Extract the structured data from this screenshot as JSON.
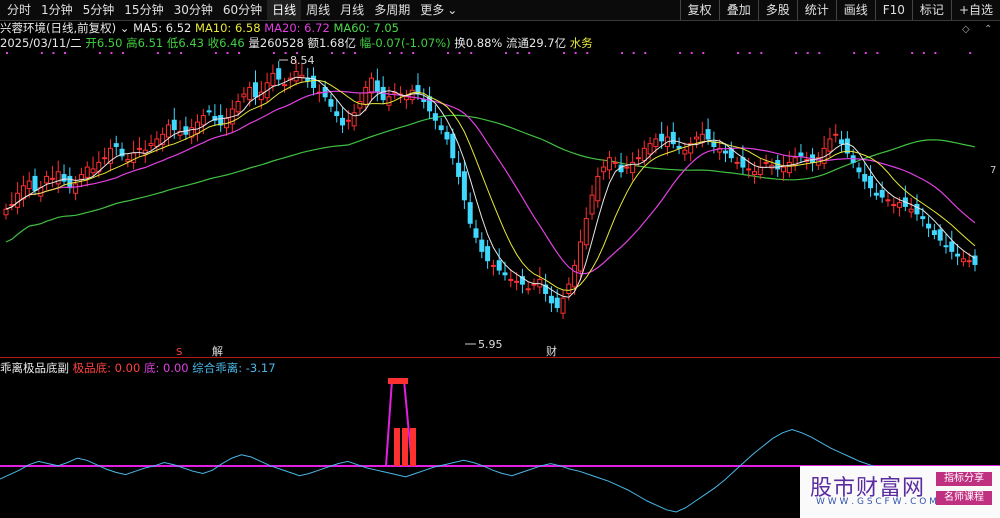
{
  "toolbar": {
    "periods": [
      "分时",
      "1分钟",
      "5分钟",
      "15分钟",
      "30分钟",
      "60分钟",
      "日线",
      "周线",
      "月线",
      "多周期",
      "更多"
    ],
    "active_period": "日线",
    "right_buttons": [
      "复权",
      "叠加",
      "多股",
      "统计",
      "画线",
      "F10",
      "标记",
      "+自选"
    ]
  },
  "info": {
    "stock_name": "兴蓉环境",
    "mode": "(日线,前复权)",
    "ma5": "MA5: 6.52",
    "ma10": "MA10: 6.58",
    "ma20": "MA20: 6.72",
    "ma60": "MA60: 7.05",
    "date": "2025/03/11/二",
    "open": "开6.50",
    "high": "高6.51",
    "low": "低6.43",
    "close": "收6.46",
    "volume": "量260528",
    "amount": "额1.68亿",
    "change": "幅-0.07(-1.07%)",
    "turnover": "换0.88%",
    "float": "流通29.7亿",
    "sector": "水务"
  },
  "annotations": {
    "high_mark": "8.54",
    "low_mark": "5.95",
    "event1": "S",
    "event2": "解",
    "event3": "财",
    "right_axis_mark": "7"
  },
  "indicator": {
    "name": "乖离极品底副",
    "label1": "极品底: 0.00",
    "label2": "底: 0.00",
    "label3": "综合乖离: -3.17"
  },
  "watermark": {
    "title": "股市财富网",
    "url": "W W W . G S C F W . C O M",
    "badge1": "指标分享",
    "badge2": "名师课程"
  },
  "colors": {
    "up": "#ff3030",
    "down": "#40d8ff",
    "ma5": "#e8e8e8",
    "ma10": "#e8e83a",
    "ma20": "#e040e0",
    "ma60": "#40c040",
    "indicator_line": "#4ab8e8",
    "indicator_base": "#e020e0"
  },
  "chart_data": {
    "type": "candlestick",
    "price_range": [
      5.95,
      8.54
    ],
    "highest": 8.54,
    "lowest": 5.95,
    "closes": [
      7.05,
      7.1,
      7.22,
      7.3,
      7.35,
      7.25,
      7.28,
      7.4,
      7.38,
      7.45,
      7.35,
      7.28,
      7.32,
      7.42,
      7.5,
      7.48,
      7.55,
      7.6,
      7.7,
      7.72,
      7.62,
      7.58,
      7.65,
      7.7,
      7.68,
      7.75,
      7.8,
      7.85,
      7.95,
      7.9,
      7.88,
      7.85,
      7.92,
      7.98,
      8.05,
      8.1,
      8.0,
      7.95,
      8.02,
      8.12,
      8.2,
      8.28,
      8.35,
      8.25,
      8.3,
      8.4,
      8.5,
      8.44,
      8.38,
      8.45,
      8.52,
      8.48,
      8.42,
      8.35,
      8.3,
      8.25,
      8.15,
      8.05,
      7.95,
      8.0,
      8.08,
      8.2,
      8.35,
      8.45,
      8.3,
      8.22,
      8.25,
      8.3,
      8.28,
      8.25,
      8.32,
      8.28,
      8.2,
      8.1,
      8.0,
      7.9,
      7.8,
      7.6,
      7.4,
      7.15,
      6.9,
      6.75,
      6.6,
      6.5,
      6.45,
      6.4,
      6.35,
      6.3,
      6.28,
      6.25,
      6.2,
      6.25,
      6.3,
      6.15,
      6.05,
      6.0,
      6.1,
      6.25,
      6.45,
      6.7,
      6.95,
      7.2,
      7.4,
      7.5,
      7.6,
      7.55,
      7.45,
      7.5,
      7.55,
      7.6,
      7.7,
      7.75,
      7.8,
      7.78,
      7.82,
      7.75,
      7.7,
      7.68,
      7.75,
      7.82,
      7.85,
      7.8,
      7.72,
      7.7,
      7.65,
      7.6,
      7.55,
      7.5,
      7.48,
      7.45,
      7.5,
      7.55,
      7.52,
      7.48,
      7.5,
      7.55,
      7.6,
      7.62,
      7.58,
      7.55,
      7.6,
      7.7,
      7.8,
      7.85,
      7.75,
      7.65,
      7.55,
      7.45,
      7.35,
      7.28,
      7.2,
      7.18,
      7.15,
      7.1,
      7.12,
      7.08,
      7.05,
      7.0,
      6.95,
      6.85,
      6.78,
      6.72,
      6.65,
      6.6,
      6.55,
      6.52,
      6.5,
      6.46
    ],
    "indicator_values": [
      -1.0,
      -0.6,
      -0.2,
      0.3,
      0.6,
      0.4,
      0.2,
      0.5,
      0.9,
      0.7,
      0.3,
      -0.1,
      -0.4,
      -0.6,
      -0.3,
      0.0,
      0.2,
      0.5,
      0.3,
      0.0,
      -0.3,
      -0.5,
      -0.2,
      0.4,
      0.9,
      1.2,
      1.0,
      0.6,
      0.2,
      -0.1,
      -0.4,
      -0.7,
      -0.5,
      -0.2,
      0.1,
      0.4,
      0.6,
      0.3,
      0.0,
      -0.2,
      -0.4,
      -0.6,
      -0.8,
      -0.5,
      -0.2,
      0.1,
      0.3,
      0.5,
      0.7,
      0.5,
      0.2,
      -0.2,
      -0.5,
      -0.7,
      -0.4,
      -0.1,
      0.2,
      0.4,
      0.2,
      -0.1,
      -0.3,
      -0.6,
      -0.9,
      -1.2,
      -1.6,
      -2.0,
      -2.5,
      -3.0,
      -3.4,
      -3.8,
      -4.0,
      -3.6,
      -3.0,
      -2.4,
      -1.8,
      -1.1,
      -0.3,
      0.5,
      1.3,
      2.0,
      2.7,
      3.2,
      3.5,
      3.2,
      2.8,
      2.3,
      1.8,
      1.4,
      1.0,
      0.6,
      0.3,
      0.0,
      -0.3,
      -0.6,
      -0.9,
      -1.2,
      -1.5,
      -1.8,
      -2.1,
      -2.4,
      -2.6,
      -2.8,
      -3.0,
      -3.17
    ]
  }
}
